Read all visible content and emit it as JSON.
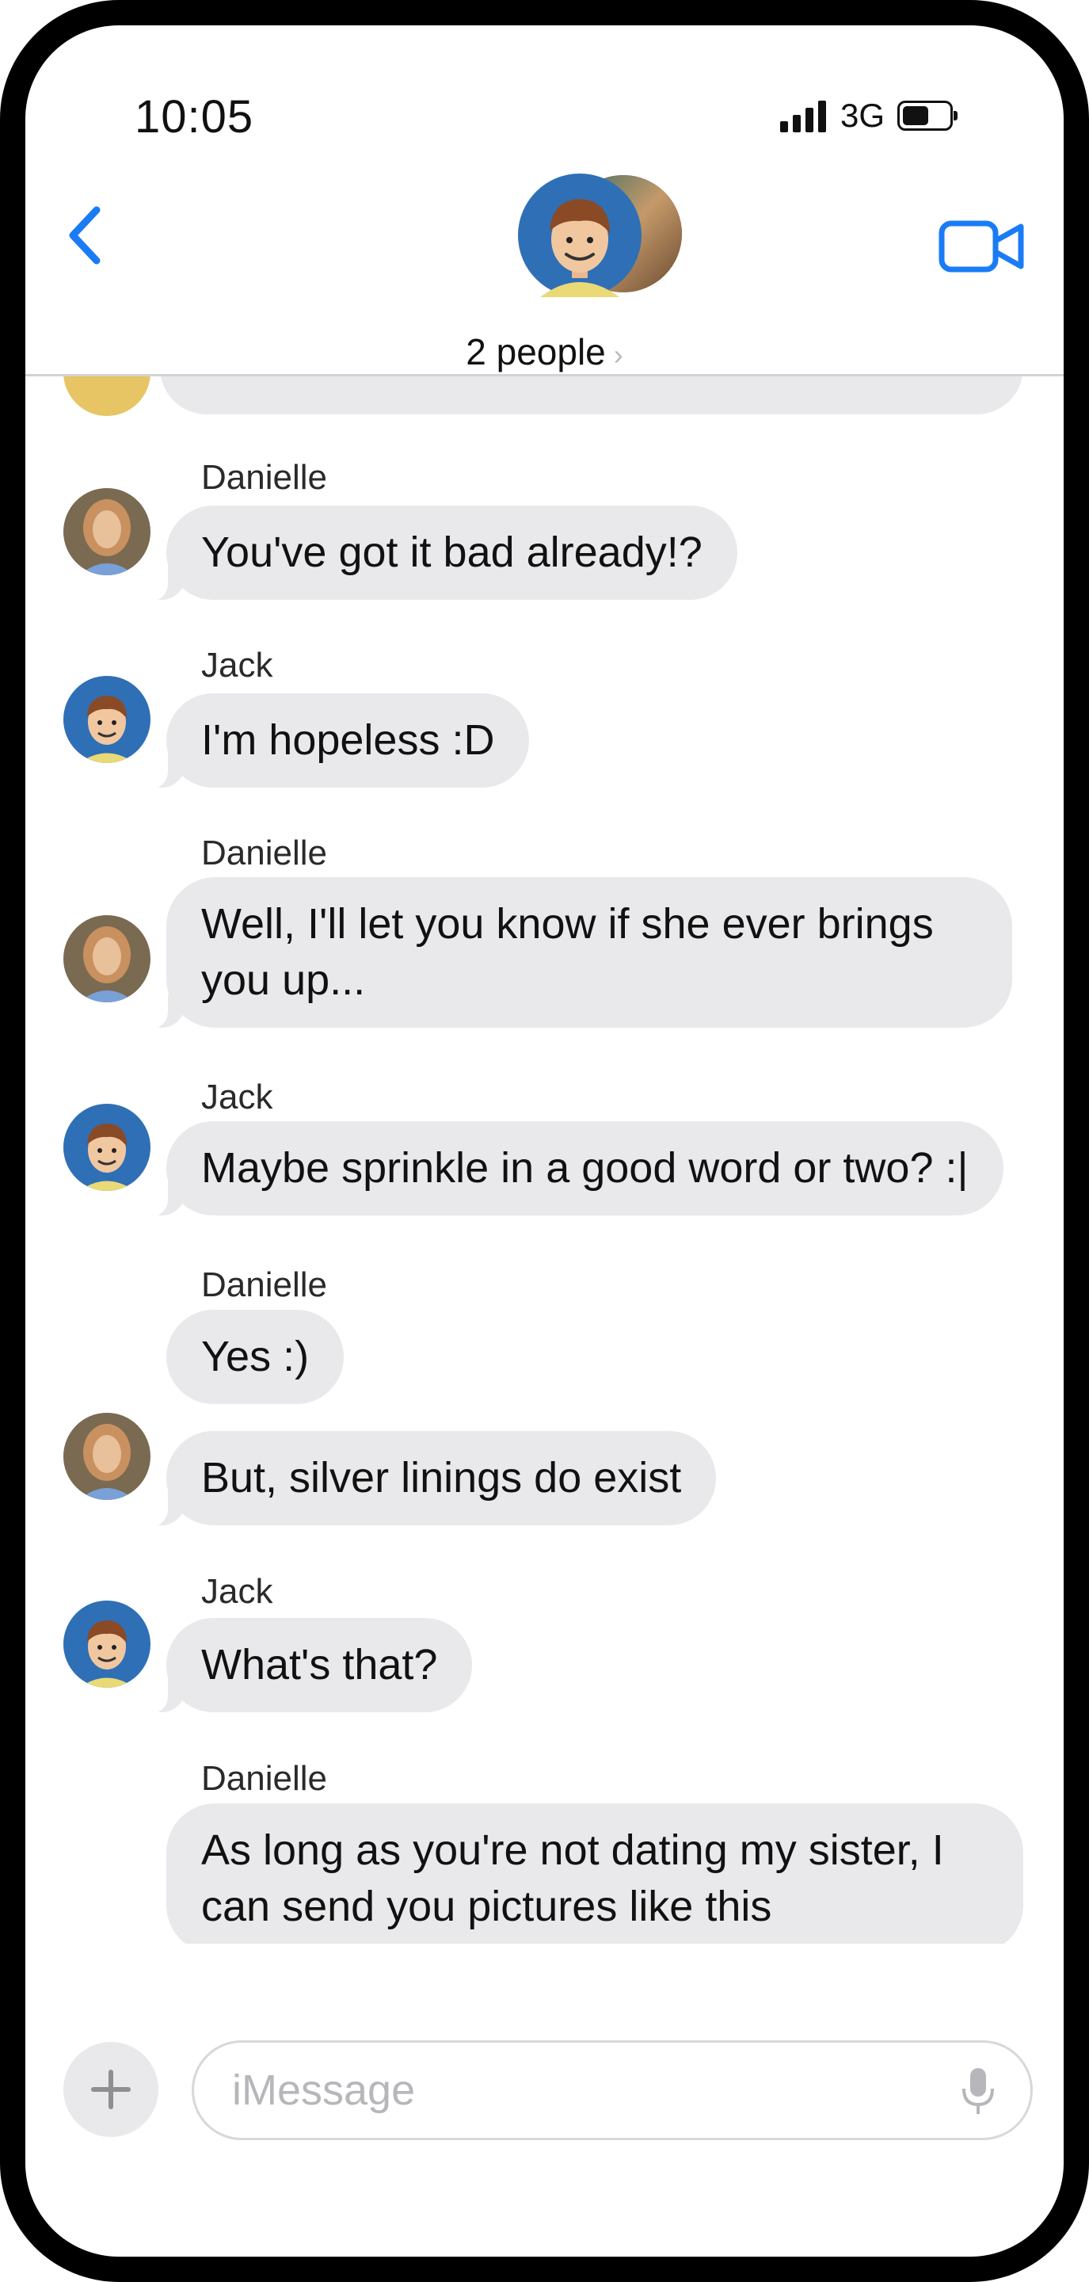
{
  "status_bar": {
    "time": "10:05",
    "network": "3G"
  },
  "nav": {
    "back_icon": "chevron-left-icon",
    "video_icon": "video-camera-icon",
    "people_label": "2 people",
    "accent_color": "#1a7cf5"
  },
  "messages": [
    {
      "sender": "Danielle",
      "text": "You've got it bad already!?"
    },
    {
      "sender": "Jack",
      "text": "I'm hopeless :D"
    },
    {
      "sender": "Danielle",
      "text": "Well, I'll let you know if she ever brings you up..."
    },
    {
      "sender": "Jack",
      "text": "Maybe sprinkle in a good word or two? :|"
    },
    {
      "sender": "Danielle",
      "text": "Yes :)"
    },
    {
      "sender": "",
      "text": "But, silver linings do exist"
    },
    {
      "sender": "Jack",
      "text": "What's that?"
    },
    {
      "sender": "Danielle",
      "text": "As long as you're not dating my sister, I can send you pictures like this"
    }
  ],
  "input": {
    "placeholder": "iMessage",
    "add_icon": "plus-icon",
    "mic_icon": "microphone-icon"
  },
  "colors": {
    "bubble_received": "#e9e9eb",
    "divider": "#d3d3d6"
  }
}
